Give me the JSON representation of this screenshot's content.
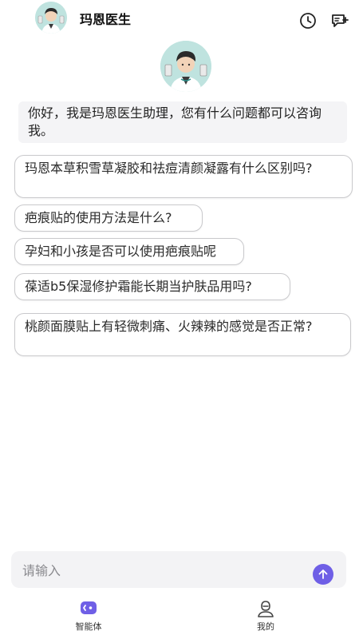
{
  "header": {
    "title": "玛恩医生",
    "history_icon": "clock-icon",
    "new_chat_icon": "new-chat-icon"
  },
  "greeting": "你好，我是玛恩医生助理，您有什么问题都可以咨询我。",
  "questions": [
    "玛恩本草积雪草凝胶和祛痘清颜凝露有什么区别吗?",
    "疤痕贴的使用方法是什么?",
    "孕妇和小孩是否可以使用疤痕贴呢",
    "葆适b5保湿修护霜能长期当护肤品用吗?",
    "桃颜面膜贴上有轻微刺痛、火辣辣的感觉是否正常?"
  ],
  "input": {
    "placeholder": "请输入"
  },
  "tabs": [
    {
      "label": "智能体",
      "icon": "agent-icon",
      "active": true
    },
    {
      "label": "我的",
      "icon": "profile-icon",
      "active": false
    }
  ],
  "colors": {
    "accent": "#6f5fe6",
    "border": "#c9c9cc",
    "greeting_bg": "#f4f4f6"
  }
}
